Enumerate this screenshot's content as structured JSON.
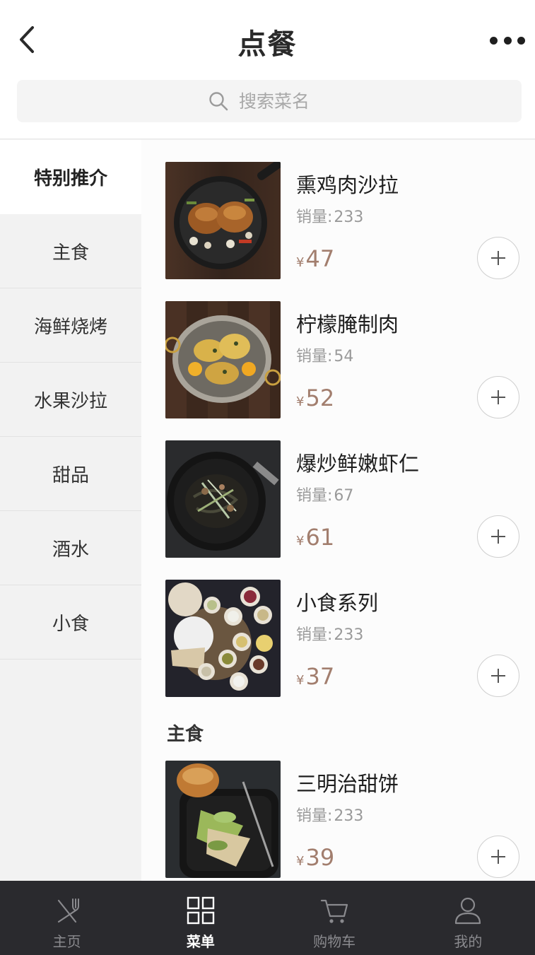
{
  "header": {
    "title": "点餐",
    "back_icon": "chevron-left-icon",
    "more_icon": "more-dots-icon"
  },
  "search": {
    "placeholder": "搜索菜名",
    "icon": "search-icon"
  },
  "sidebar": {
    "items": [
      {
        "label": "特别推介",
        "active": true
      },
      {
        "label": "主食",
        "active": false
      },
      {
        "label": "海鲜烧烤",
        "active": false
      },
      {
        "label": "水果沙拉",
        "active": false
      },
      {
        "label": "甜品",
        "active": false
      },
      {
        "label": "酒水",
        "active": false
      },
      {
        "label": "小食",
        "active": false
      }
    ]
  },
  "menu": {
    "sales_label": "销量:",
    "currency": "¥",
    "dishes": [
      {
        "name": "熏鸡肉沙拉",
        "sales": "233",
        "price": "47",
        "image": "roast-chicken-pan-image"
      },
      {
        "name": "柠檬腌制肉",
        "sales": "54",
        "price": "52",
        "image": "lemon-chicken-pan-image"
      },
      {
        "name": "爆炒鲜嫩虾仁",
        "sales": "67",
        "price": "61",
        "image": "squid-ink-pasta-image"
      },
      {
        "name": "小食系列",
        "sales": "233",
        "price": "37",
        "image": "dips-platter-image"
      },
      {
        "name": "三明治甜饼",
        "sales": "233",
        "price": "39",
        "image": "sandwich-skillet-image"
      }
    ],
    "sections": [
      {
        "title": "主食"
      }
    ],
    "add_icon": "plus-icon"
  },
  "tabbar": {
    "tabs": [
      {
        "label": "主页",
        "icon": "fork-knife-icon",
        "active": false
      },
      {
        "label": "菜单",
        "icon": "grid-icon",
        "active": true
      },
      {
        "label": "购物车",
        "icon": "cart-icon",
        "active": false
      },
      {
        "label": "我的",
        "icon": "user-icon",
        "active": false
      }
    ]
  },
  "colors": {
    "price": "#a27e6e",
    "tabbar_bg": "#2a2a2e",
    "sidebar_bg": "#f2f2f2"
  }
}
